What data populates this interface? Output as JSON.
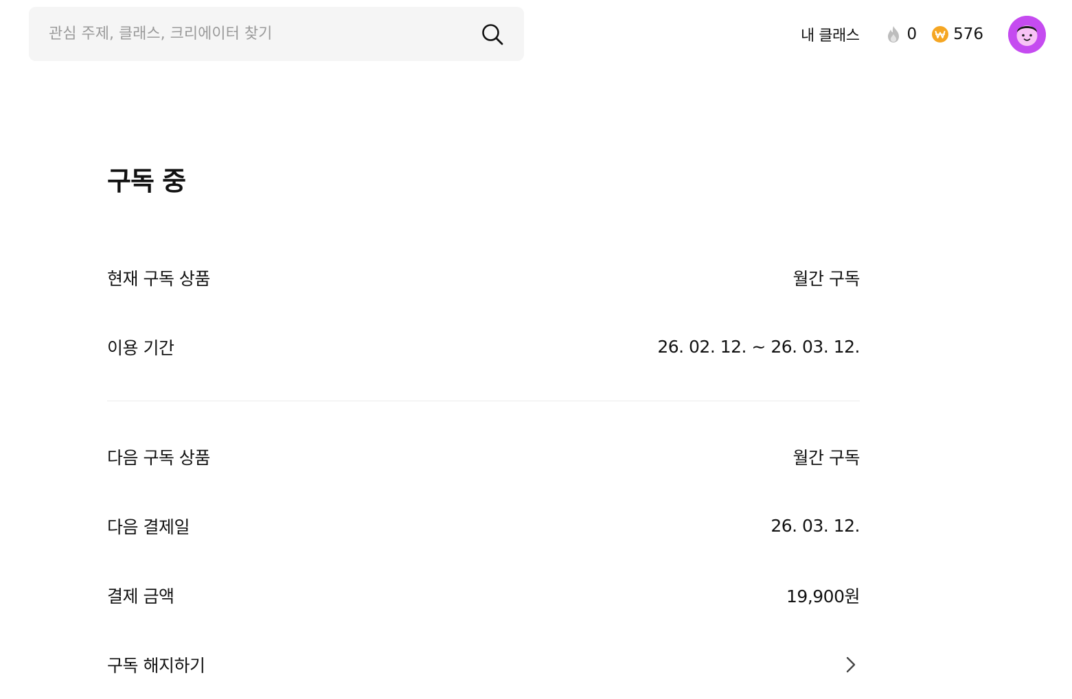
{
  "search": {
    "placeholder": "관심 주제, 클래스, 크리에이터 찾기",
    "value": "",
    "icon": "search-icon"
  },
  "header": {
    "my_class_label": "내 클래스",
    "fire_count": "0",
    "fire_icon": "fire-icon",
    "coin_count": "576",
    "coin_icon": "won-coin-icon",
    "avatar_icon": "avatar-face-icon",
    "colors": {
      "avatar_bg": "#c54bf0",
      "coin": "#f5a623",
      "fire": "#b9b9b9"
    }
  },
  "main": {
    "title": "구독 중",
    "current": [
      {
        "label": "현재 구독 상품",
        "value": "월간 구독"
      },
      {
        "label": "이용 기간",
        "value": "26. 02. 12. ~ 26. 03. 12."
      }
    ],
    "next": [
      {
        "label": "다음 구독 상품",
        "value": "월간 구독"
      },
      {
        "label": "다음 결제일",
        "value": "26. 03. 12."
      },
      {
        "label": "결제 금액",
        "value": "19,900원"
      }
    ],
    "cancel_label": "구독 해지하기",
    "cancel_icon": "chevron-right-icon"
  }
}
